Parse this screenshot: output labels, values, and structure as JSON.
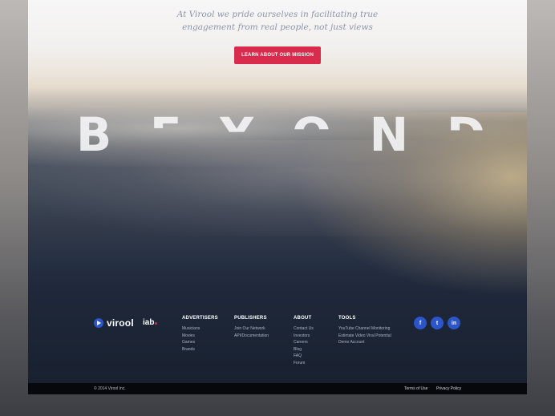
{
  "hero": {
    "tagline_line1": "At Virool we pride ourselves in facilitating true",
    "tagline_line2": "engagement from real people, not just views",
    "cta_label": "LEARN ABOUT OUR MISSION",
    "headline_letters": [
      "B",
      "E",
      "Y",
      "O",
      "N",
      "D"
    ]
  },
  "footer": {
    "brand": "virool",
    "partner": "iab",
    "columns": [
      {
        "title": "ADVERTISERS",
        "links": [
          "Musicians",
          "Movies",
          "Games",
          "Brands"
        ]
      },
      {
        "title": "PUBLISHERS",
        "links": [
          "Join Our Network",
          "API/Documentation"
        ]
      },
      {
        "title": "ABOUT",
        "links": [
          "Contact Us",
          "Investors",
          "Careers",
          "Blog",
          "FAQ",
          "Forum"
        ]
      },
      {
        "title": "TOOLS",
        "links": [
          "YouTube Channel Monitoring",
          "Estimate Video Viral Potential",
          "Demo Account"
        ]
      }
    ],
    "social": [
      {
        "icon": "facebook-icon",
        "glyph": "f"
      },
      {
        "icon": "twitter-icon",
        "glyph": "t"
      },
      {
        "icon": "linkedin-icon",
        "glyph": "in"
      }
    ],
    "copyright": "© 2014 Virool Inc.",
    "terms": "Terms of Use",
    "privacy": "Privacy Policy"
  },
  "colors": {
    "accent": "#d92b4b",
    "brand_blue": "#2b55c9",
    "footer_bar": "#06080c"
  }
}
